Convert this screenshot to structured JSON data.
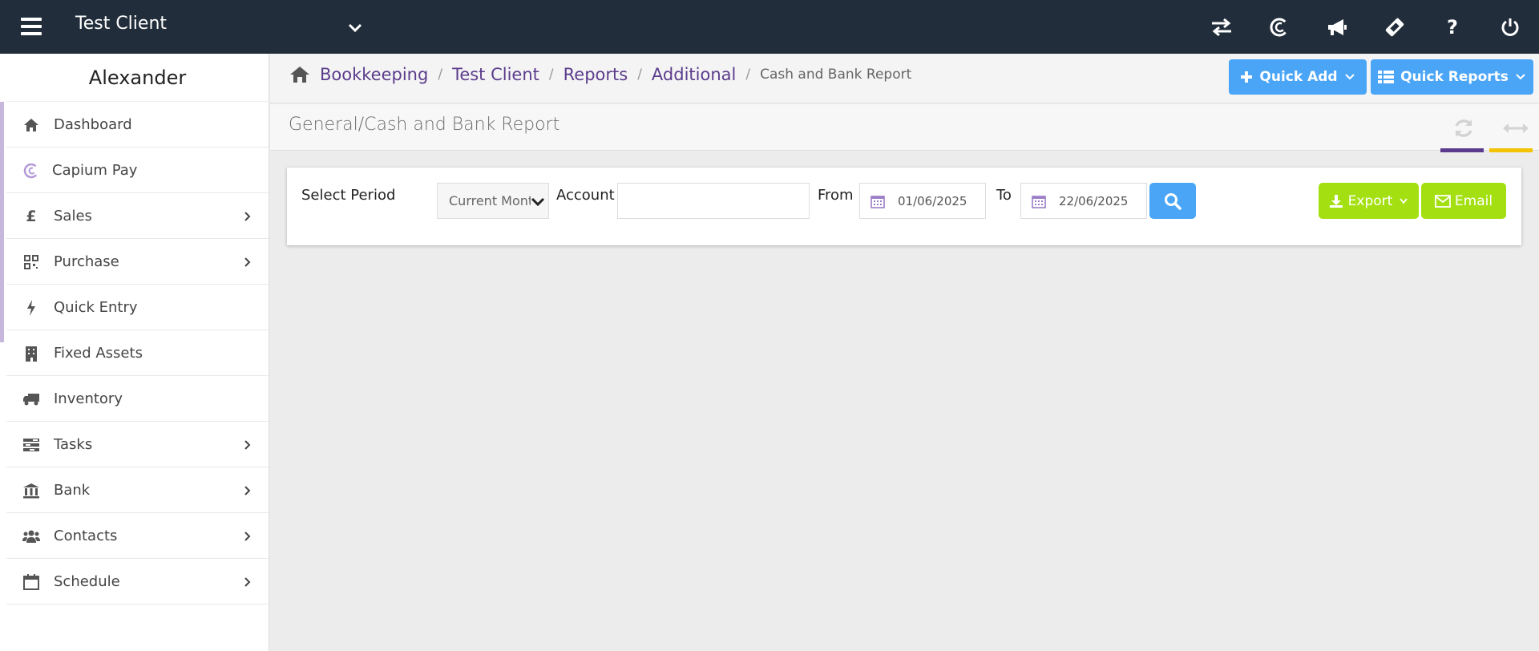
{
  "topbar": {
    "client_name": "Test Client",
    "icons": [
      "transfer-icon",
      "capium-icon",
      "megaphone-icon",
      "ticket-icon",
      "help-icon",
      "power-icon"
    ],
    "help_glyph": "?"
  },
  "sidebar": {
    "user_name": "Alexander",
    "items": [
      {
        "label": "Dashboard",
        "icon": "home-icon",
        "submenu": false
      },
      {
        "label": "Capium Pay",
        "icon": "capium-pay-icon",
        "submenu": false
      },
      {
        "label": "Sales",
        "icon": "pound-icon",
        "submenu": true
      },
      {
        "label": "Purchase",
        "icon": "qrcode-icon",
        "submenu": true
      },
      {
        "label": "Quick Entry",
        "icon": "bolt-icon",
        "submenu": false
      },
      {
        "label": "Fixed Assets",
        "icon": "building-icon",
        "submenu": false
      },
      {
        "label": "Inventory",
        "icon": "truck-icon",
        "submenu": false
      },
      {
        "label": "Tasks",
        "icon": "tasks-icon",
        "submenu": true
      },
      {
        "label": "Bank",
        "icon": "bank-icon",
        "submenu": true
      },
      {
        "label": "Contacts",
        "icon": "users-icon",
        "submenu": true
      },
      {
        "label": "Schedule",
        "icon": "calendar-icon",
        "submenu": true
      }
    ],
    "pound_glyph": "£"
  },
  "breadcrumb": {
    "items": [
      "Bookkeeping",
      "Test Client",
      "Reports",
      "Additional"
    ],
    "current": "Cash and Bank Report",
    "separator": "/"
  },
  "actions": {
    "quick_add": "Quick Add",
    "quick_reports": "Quick Reports"
  },
  "page": {
    "title": "General/Cash and Bank Report"
  },
  "filters": {
    "period_label": "Select Period",
    "period_value": "Current Month",
    "account_label": "Account",
    "account_value": "",
    "from_label": "From",
    "from_value": "01/06/2025",
    "to_label": "To",
    "to_value": "22/06/2025",
    "export_label": "Export",
    "email_label": "Email"
  },
  "colors": {
    "topbar": "#222d3b",
    "brand_purple": "#5b3c8c",
    "primary_blue": "#4aa5f7",
    "export_green": "#a4e011",
    "accent_yellow": "#f3c200"
  }
}
